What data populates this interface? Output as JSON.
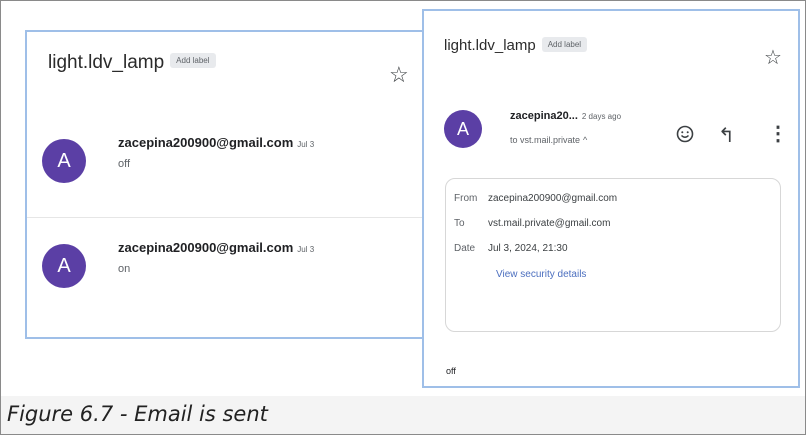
{
  "left_panel": {
    "subject": "light.ldv_lamp",
    "label_chip": "Add label",
    "star_icon": "star-outline-icon",
    "messages": [
      {
        "avatar": "A",
        "sender": "zacepina200900@gmail.com",
        "date": "Jul 3",
        "snippet": "off"
      },
      {
        "avatar": "A",
        "sender": "zacepina200900@gmail.com",
        "date": "Jul 3",
        "snippet": "on"
      }
    ]
  },
  "right_panel": {
    "subject": "light.ldv_lamp",
    "label_chip": "Add label",
    "avatar": "A",
    "sender": "zacepina20...",
    "date": "2 days ago",
    "to_line": "to vst.mail.private",
    "details": {
      "from_label": "From",
      "from_value": "zacepina200900@gmail.com",
      "to_label": "To",
      "to_value": "vst.mail.private@gmail.com",
      "date_label": "Date",
      "date_value": "Jul 3, 2024, 21:30",
      "security_link": "View security details"
    },
    "body": "off",
    "icons": [
      "star-outline-icon",
      "emoji-icon",
      "reply-icon",
      "more-vert-icon",
      "chevron-up-icon"
    ]
  },
  "caption": "Figure 6.7 - Email is sent",
  "colors": {
    "avatar": "#5b3fa5",
    "panel_border": "#9fbfe8",
    "link": "#4c6fbf"
  }
}
